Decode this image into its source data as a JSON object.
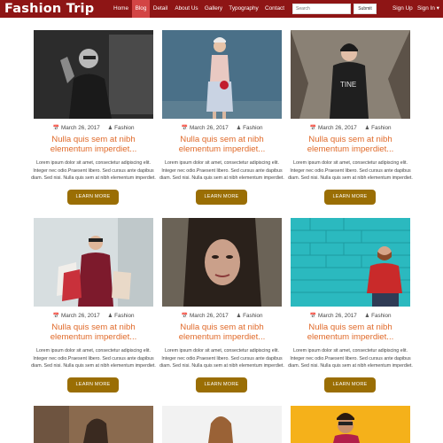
{
  "brand": "Fashion Trip",
  "nav": {
    "items": [
      {
        "label": "Home"
      },
      {
        "label": "Blog",
        "active": true
      },
      {
        "label": "Detail"
      },
      {
        "label": "About Us"
      },
      {
        "label": "Gallery"
      },
      {
        "label": "Typography"
      },
      {
        "label": "Contact"
      }
    ],
    "search_placeholder": "Search",
    "submit_label": "Submit",
    "sign_up": "Sign Up",
    "sign_in": "Sign In ▾"
  },
  "icons": {
    "calendar": "calendar-icon",
    "user": "user-icon"
  },
  "colors": {
    "navbar": "#8e1515",
    "nav_active": "#d34545",
    "title": "#e06a2a",
    "button": "#9a6e04"
  },
  "posts": [
    {
      "date": "March 26, 2017",
      "author": "Fashion",
      "title": "Nulla quis sem at nibh elementum imperdiet...",
      "excerpt": "Lorem ipsum dolor sit amet, consectetur adipiscing elit. Integer nec odio.Praesent libero. Sed cursus ante dapibus diam. Sed nisi. Nulla quis sem at nibh elementum imperdiet.",
      "button": "LEARN MORE"
    },
    {
      "date": "March 26, 2017",
      "author": "Fashion",
      "title": "Nulla quis sem at nibh elementum imperdiet...",
      "excerpt": "Lorem ipsum dolor sit amet, consectetur adipiscing elit. Integer nec odio.Praesent libero. Sed cursus ante dapibus diam. Sed nisi. Nulla quis sem at nibh elementum imperdiet.",
      "button": "LEARN MORE"
    },
    {
      "date": "March 26, 2017",
      "author": "Fashion",
      "title": "Nulla quis sem at nibh elementum imperdiet...",
      "excerpt": "Lorem ipsum dolor sit amet, consectetur adipiscing elit. Integer nec odio.Praesent libero. Sed cursus ante dapibus diam. Sed nisi. Nulla quis sem at nibh elementum imperdiet.",
      "button": "LEARN MORE"
    },
    {
      "date": "March 26, 2017",
      "author": "Fashion",
      "title": "Nulla quis sem at nibh elementum imperdiet...",
      "excerpt": "Lorem ipsum dolor sit amet, consectetur adipiscing elit. Integer nec odio.Praesent libero. Sed cursus ante dapibus diam. Sed nisi. Nulla quis sem at nibh elementum imperdiet.",
      "button": "LEARN MORE"
    },
    {
      "date": "March 26, 2017",
      "author": "Fashion",
      "title": "Nulla quis sem at nibh elementum imperdiet...",
      "excerpt": "Lorem ipsum dolor sit amet, consectetur adipiscing elit. Integer nec odio.Praesent libero. Sed cursus ante dapibus diam. Sed nisi. Nulla quis sem at nibh elementum imperdiet.",
      "button": "LEARN MORE"
    },
    {
      "date": "March 26, 2017",
      "author": "Fashion",
      "title": "Nulla quis sem at nibh elementum imperdiet...",
      "excerpt": "Lorem ipsum dolor sit amet, consectetur adipiscing elit. Integer nec odio.Praesent libero. Sed cursus ante dapibus diam. Sed nisi. Nulla quis sem at nibh elementum imperdiet.",
      "button": "LEARN MORE"
    },
    {
      "date": "",
      "author": "",
      "title": "",
      "excerpt": "",
      "button": ""
    },
    {
      "date": "",
      "author": "",
      "title": "",
      "excerpt": "",
      "button": ""
    },
    {
      "date": "",
      "author": "",
      "title": "",
      "excerpt": "",
      "button": ""
    }
  ]
}
